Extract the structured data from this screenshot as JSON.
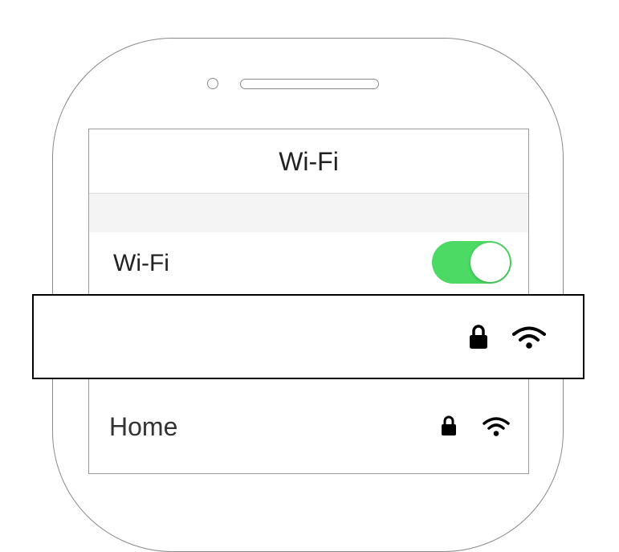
{
  "navigation": {
    "title": "Wi-Fi"
  },
  "wifi_toggle": {
    "label": "Wi-Fi",
    "state": "on",
    "on_color": "#4cd964"
  },
  "connected_network": {
    "name": "",
    "icons": [
      "lock-icon",
      "wifi-signal-icon"
    ]
  },
  "networks": [
    {
      "name": "Home",
      "icons": [
        "lock-icon",
        "wifi-signal-icon"
      ]
    }
  ]
}
